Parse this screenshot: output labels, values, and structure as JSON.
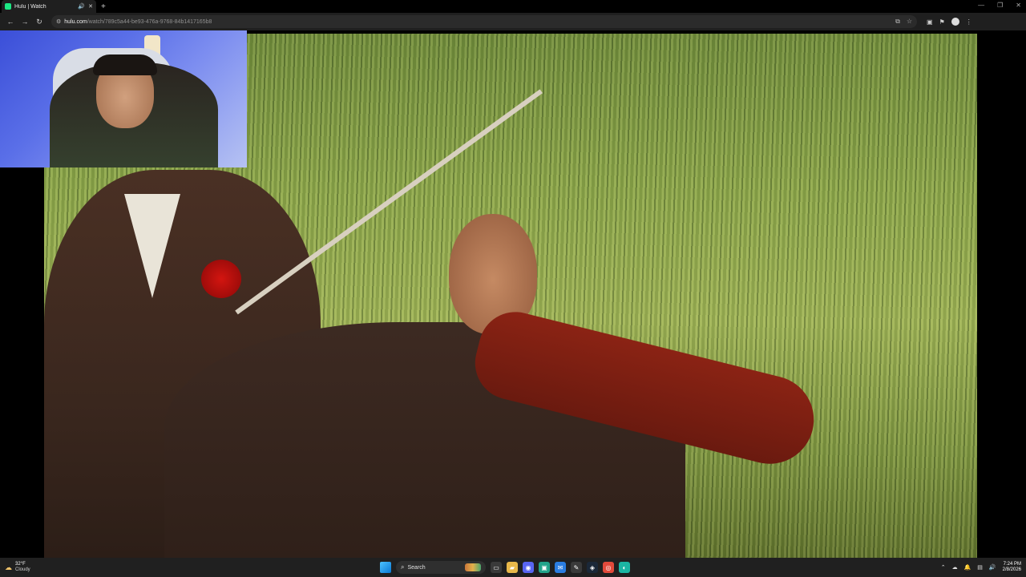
{
  "browser": {
    "tab": {
      "title": "Hulu | Watch",
      "favicon": "hulu-favicon",
      "audio_icon": "🔊",
      "close_icon": "✕"
    },
    "new_tab_icon": "+",
    "window_controls": [
      "—",
      "❐",
      "✕"
    ],
    "nav": {
      "back": "←",
      "forward": "→",
      "reload": "↻"
    },
    "address": {
      "host": "hulu.com",
      "path": "/watch/789c5a44-be93-476a-9768-84b1417165b8"
    },
    "omnibox_actions": [
      "⧉",
      "☆"
    ],
    "toolbar_icons": [
      "▣",
      "⚑",
      "⋮"
    ]
  },
  "player": {
    "content": "video",
    "webcam_overlay": true
  },
  "taskbar": {
    "weather": {
      "temp": "32°F",
      "condition": "Cloudy",
      "icon": "☁"
    },
    "search_label": "Search",
    "search_icon": "⌕",
    "apps": [
      {
        "name": "task-view",
        "glyph": "▭",
        "color": "#3a3a3a"
      },
      {
        "name": "file-explorer",
        "glyph": "▰",
        "color": "#e8b84a"
      },
      {
        "name": "discord",
        "glyph": "◉",
        "color": "#5865f2"
      },
      {
        "name": "app-teal",
        "glyph": "▣",
        "color": "#22a38a"
      },
      {
        "name": "mail",
        "glyph": "✉",
        "color": "#2a7de1"
      },
      {
        "name": "app-pen",
        "glyph": "✎",
        "color": "#3a3a3a"
      },
      {
        "name": "steam",
        "glyph": "◈",
        "color": "#1b2838"
      },
      {
        "name": "chrome",
        "glyph": "◎",
        "color": "#e24a3b"
      },
      {
        "name": "edge",
        "glyph": "◐",
        "color": "#1bb5a3"
      }
    ],
    "tray_icons": [
      "⌃",
      "☁",
      "🔔",
      "▤",
      "🔊"
    ],
    "clock": {
      "time": "7:24 PM",
      "date": "2/8/2026"
    }
  }
}
